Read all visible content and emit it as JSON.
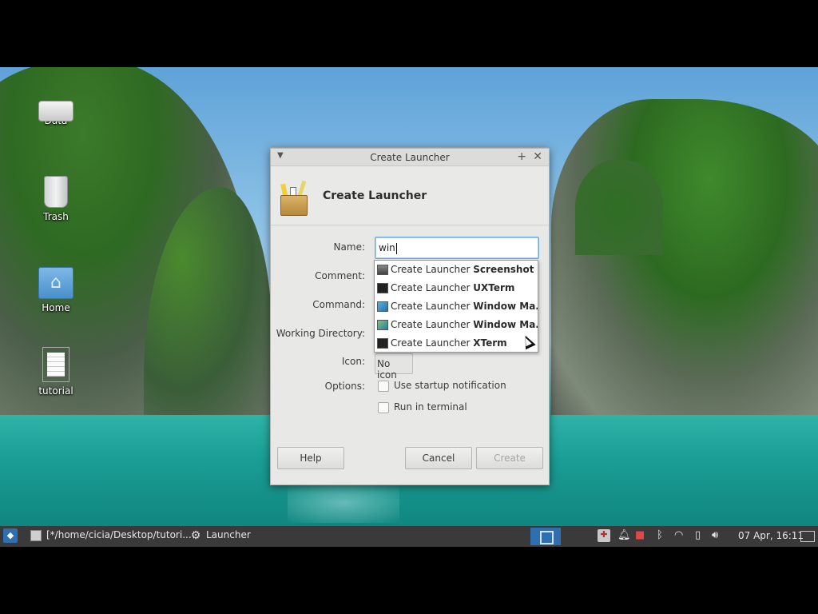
{
  "desktop": {
    "icons": [
      {
        "label": "Data",
        "icon": "drive-icon"
      },
      {
        "label": "Trash",
        "icon": "trash-icon"
      },
      {
        "label": "Home",
        "icon": "home-folder-icon"
      },
      {
        "label": "tutorial",
        "icon": "document-icon"
      }
    ]
  },
  "dialog": {
    "window_title": "Create Launcher",
    "header_title": "Create Launcher",
    "labels": {
      "name": "Name:",
      "comment": "Comment:",
      "command": "Command:",
      "working_directory": "Working Directory:",
      "icon": "Icon:",
      "options": "Options:"
    },
    "name_value": "win",
    "icon_button_label": "No icon",
    "options": {
      "startup_notification": "Use startup notification",
      "run_in_terminal": "Run in terminal"
    },
    "buttons": {
      "help": "Help",
      "cancel": "Cancel",
      "create": "Create"
    }
  },
  "completion": {
    "items": [
      {
        "prefix": "Create Launcher ",
        "bold": "Screenshot",
        "icon": "screenshot-icon"
      },
      {
        "prefix": "Create Launcher ",
        "bold": "UXTerm",
        "icon": "terminal-icon"
      },
      {
        "prefix": "Create Launcher ",
        "bold": "Window Ma...",
        "icon": "window-manager-icon"
      },
      {
        "prefix": "Create Launcher ",
        "bold": "Window Ma...",
        "icon": "window-manager-settings-icon"
      },
      {
        "prefix": "Create Launcher ",
        "bold": "XTerm",
        "icon": "terminal-icon"
      }
    ]
  },
  "taskbar": {
    "tasks": [
      {
        "label": "[*/home/cicia/Desktop/tutori...",
        "icon": "text-editor-icon"
      },
      {
        "label": "Launcher",
        "icon": "gear-icon"
      }
    ],
    "clock": "07 Apr, 16:11"
  },
  "colors": {
    "accent": "#2f6fb0",
    "taskbar_bg": "#3a3a3a",
    "dialog_bg": "#e8e8e7",
    "input_focus": "#6fa8dc"
  }
}
